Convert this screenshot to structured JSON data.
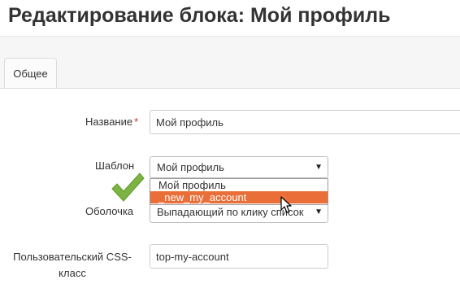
{
  "header": {
    "title": "Редактирование блока: Мой профиль"
  },
  "tabs": [
    {
      "label": "Общее",
      "active": true
    }
  ],
  "form": {
    "name": {
      "label": "Название",
      "required_mark": "*",
      "value": "Мой профиль"
    },
    "template": {
      "label": "Шаблон",
      "selected": "Мой профиль",
      "options": [
        "Мой профиль",
        "_new_my_account"
      ],
      "highlighted_option": "_new_my_account"
    },
    "wrapper": {
      "label": "Оболочка",
      "selected": "Выпадающий по клику список"
    },
    "css_class": {
      "label": "Пользовательский CSS-класс",
      "value": "top-my-account"
    }
  },
  "icons": {
    "checkmark": "check-icon",
    "cursor": "mouse-pointer-icon",
    "dropdown_arrow": "chevron-down-icon"
  },
  "colors": {
    "highlight": "#ea6e38",
    "required": "#c9302c",
    "checkmark": "#7cb342"
  }
}
